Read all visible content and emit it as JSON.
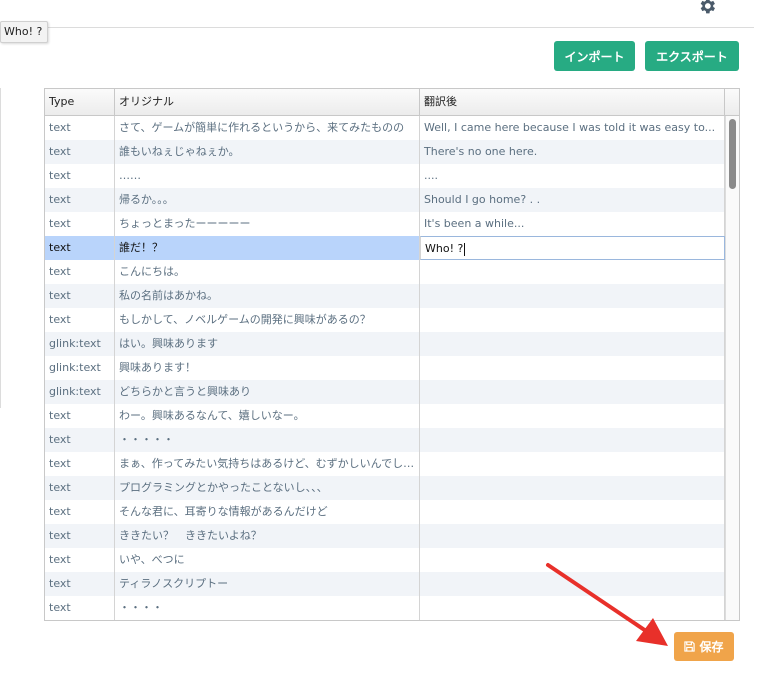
{
  "header": {
    "settings_icon": "gear-icon"
  },
  "tooltip": {
    "text": "Who! ?"
  },
  "toolbar": {
    "import_label": "インポート",
    "export_label": "エクスポート"
  },
  "table": {
    "columns": [
      "Type",
      "オリジナル",
      "翻訳後"
    ],
    "selected_row_index": 5,
    "rows": [
      {
        "type": "text",
        "original": "さて、ゲームが簡単に作れるというから、来てみたものの",
        "translation": "Well, I came here because I was told it was easy to..."
      },
      {
        "type": "text",
        "original": "誰もいねぇじゃねぇか。",
        "translation": "There's no one here."
      },
      {
        "type": "text",
        "original": "……",
        "translation": "...."
      },
      {
        "type": "text",
        "original": "帰るか。。。",
        "translation": "Should I go home? . ."
      },
      {
        "type": "text",
        "original": "ちょっとまったーーーーー",
        "translation": "It's been a while..."
      },
      {
        "type": "text",
        "original": "誰だ！？",
        "translation": "Who! ?"
      },
      {
        "type": "text",
        "original": "こんにちは。",
        "translation": ""
      },
      {
        "type": "text",
        "original": "私の名前はあかね。",
        "translation": ""
      },
      {
        "type": "text",
        "original": "もしかして、ノベルゲームの開発に興味があるの？",
        "translation": ""
      },
      {
        "type": "glink:text",
        "original": "はい。興味あります",
        "translation": ""
      },
      {
        "type": "glink:text",
        "original": "興味あります！",
        "translation": ""
      },
      {
        "type": "glink:text",
        "original": "どちらかと言うと興味あり",
        "translation": ""
      },
      {
        "type": "text",
        "original": "わー。興味あるなんて、嬉しいなー。",
        "translation": ""
      },
      {
        "type": "text",
        "original": "・・・・・",
        "translation": ""
      },
      {
        "type": "text",
        "original": "まぁ、作ってみたい気持ちはあるけど、むずかしいんでしょ?",
        "translation": ""
      },
      {
        "type": "text",
        "original": "プログラミングとかやったことないし、、、",
        "translation": ""
      },
      {
        "type": "text",
        "original": "そんな君に、耳寄りな情報があるんだけど",
        "translation": ""
      },
      {
        "type": "text",
        "original": "ききたい？　ききたいよね？",
        "translation": ""
      },
      {
        "type": "text",
        "original": "いや、べつに",
        "translation": ""
      },
      {
        "type": "text",
        "original": "ティラノスクリプトー",
        "translation": ""
      },
      {
        "type": "text",
        "original": "・・・・",
        "translation": ""
      }
    ]
  },
  "footer": {
    "save_label": "保存",
    "save_icon": "floppy-disk-icon"
  },
  "annotation": {
    "arrow_color": "#e8302a"
  },
  "colors": {
    "primary_button": "#27ab83",
    "save_button": "#f0a44a",
    "selected_row": "#b9d4fb"
  }
}
